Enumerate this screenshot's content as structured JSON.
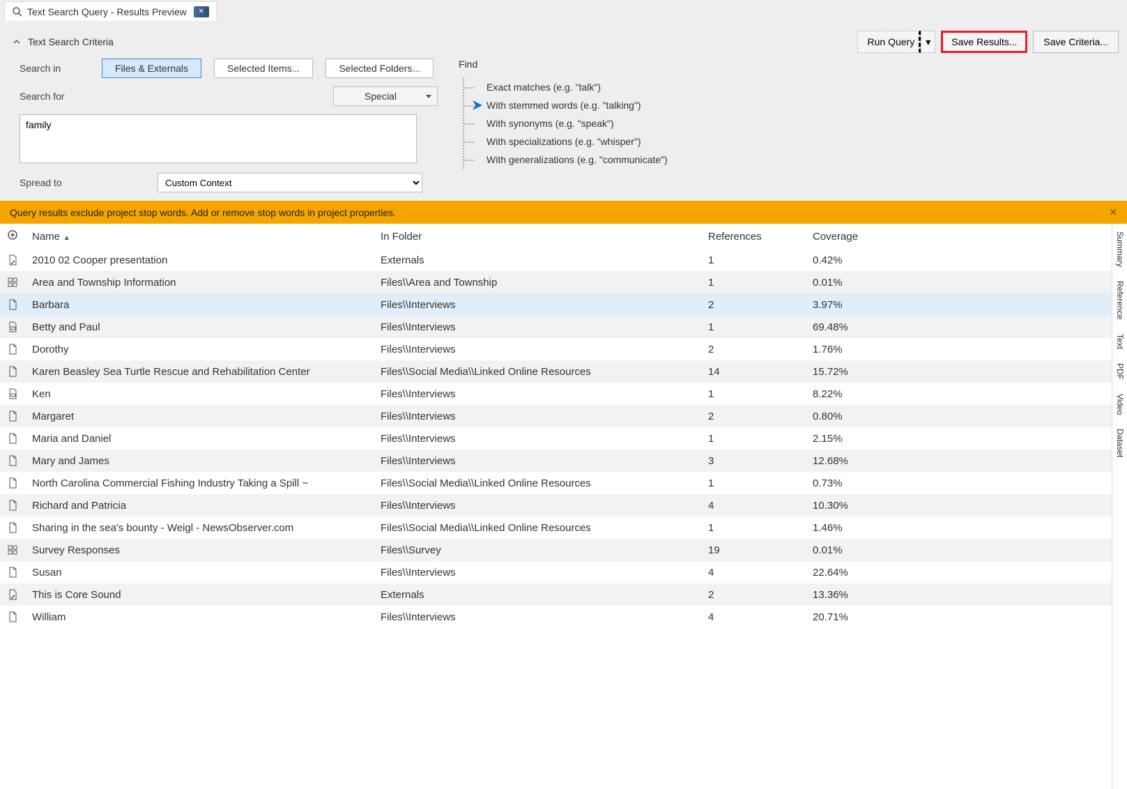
{
  "tab": {
    "title": "Text Search Query - Results Preview"
  },
  "criteria": {
    "header": "Text Search Criteria",
    "buttons": {
      "run": "Run Query",
      "save_results": "Save Results...",
      "save_criteria": "Save Criteria..."
    },
    "search_in_label": "Search in",
    "search_in_options": {
      "files": "Files & Externals",
      "items": "Selected Items...",
      "folders": "Selected Folders..."
    },
    "search_for_label": "Search for",
    "special_label": "Special",
    "search_for_value": "family",
    "spread_label": "Spread to",
    "spread_value": "Custom Context",
    "find_label": "Find",
    "find_options": [
      "Exact matches (e.g. \"talk\")",
      "With stemmed words (e.g. \"talking\")",
      "With synonyms (e.g. \"speak\")",
      "With specializations (e.g. \"whisper\")",
      "With generalizations (e.g. \"communicate\")"
    ],
    "find_active_index": 1
  },
  "banner": "Query results exclude project stop words. Add or remove stop words in project properties.",
  "columns": {
    "name": "Name",
    "folder": "In Folder",
    "refs": "References",
    "cov": "Coverage"
  },
  "rows": [
    {
      "icon": "doc-link",
      "name": "2010 02 Cooper presentation",
      "folder": "Externals",
      "refs": "1",
      "cov": "0.42%"
    },
    {
      "icon": "grid",
      "name": "Area and Township Information",
      "folder": "Files\\\\Area and Township",
      "refs": "1",
      "cov": "0.01%"
    },
    {
      "icon": "doc",
      "name": "Barbara",
      "folder": "Files\\\\Interviews",
      "refs": "2",
      "cov": "3.97%",
      "selected": true
    },
    {
      "icon": "doc-chat",
      "name": "Betty and Paul",
      "folder": "Files\\\\Interviews",
      "refs": "1",
      "cov": "69.48%"
    },
    {
      "icon": "doc",
      "name": "Dorothy",
      "folder": "Files\\\\Interviews",
      "refs": "2",
      "cov": "1.76%"
    },
    {
      "icon": "doc",
      "name": "Karen Beasley Sea Turtle Rescue and Rehabilitation Center",
      "folder": "Files\\\\Social Media\\\\Linked Online Resources",
      "refs": "14",
      "cov": "15.72%"
    },
    {
      "icon": "doc-chat",
      "name": "Ken",
      "folder": "Files\\\\Interviews",
      "refs": "1",
      "cov": "8.22%"
    },
    {
      "icon": "doc",
      "name": "Margaret",
      "folder": "Files\\\\Interviews",
      "refs": "2",
      "cov": "0.80%"
    },
    {
      "icon": "doc",
      "name": "Maria and Daniel",
      "folder": "Files\\\\Interviews",
      "refs": "1",
      "cov": "2.15%"
    },
    {
      "icon": "doc",
      "name": "Mary and James",
      "folder": "Files\\\\Interviews",
      "refs": "3",
      "cov": "12.68%"
    },
    {
      "icon": "doc",
      "name": "North Carolina Commercial Fishing Industry Taking a Spill ~",
      "folder": "Files\\\\Social Media\\\\Linked Online Resources",
      "refs": "1",
      "cov": "0.73%"
    },
    {
      "icon": "doc",
      "name": "Richard and Patricia",
      "folder": "Files\\\\Interviews",
      "refs": "4",
      "cov": "10.30%"
    },
    {
      "icon": "doc",
      "name": "Sharing in the sea's bounty - Weigl - NewsObserver.com",
      "folder": "Files\\\\Social Media\\\\Linked Online Resources",
      "refs": "1",
      "cov": "1.46%"
    },
    {
      "icon": "grid",
      "name": "Survey Responses",
      "folder": "Files\\\\Survey",
      "refs": "19",
      "cov": "0.01%"
    },
    {
      "icon": "doc",
      "name": "Susan",
      "folder": "Files\\\\Interviews",
      "refs": "4",
      "cov": "22.64%"
    },
    {
      "icon": "doc-link",
      "name": "This is Core Sound",
      "folder": "Externals",
      "refs": "2",
      "cov": "13.36%"
    },
    {
      "icon": "doc",
      "name": "William",
      "folder": "Files\\\\Interviews",
      "refs": "4",
      "cov": "20.71%"
    }
  ],
  "side_tabs": [
    "Summary",
    "Reference",
    "Text",
    "PDF",
    "Video",
    "Dataset"
  ]
}
